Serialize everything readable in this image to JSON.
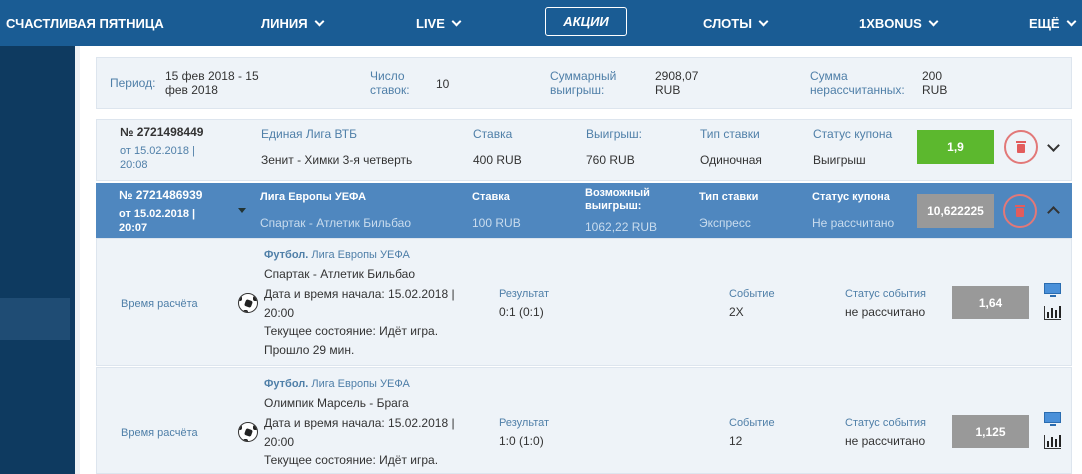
{
  "nav": {
    "items": [
      "СЧАСТЛИВАЯ ПЯТНИЦА",
      "ЛИНИЯ",
      "LIVE",
      "АКЦИИ",
      "СЛОТЫ",
      "1XBONUS",
      "ЕЩЁ"
    ]
  },
  "summary": {
    "period_label": "Период:",
    "period_value": "15 фев 2018 - 15 фев 2018",
    "bets_label": "Число ставок:",
    "bets_value": "10",
    "total_win_label": "Суммарный выигрыш:",
    "total_win_value": "2908,07 RUB",
    "unsettled_label": "Сумма нерассчитанных:",
    "unsettled_value": "200 RUB"
  },
  "coupons": [
    {
      "number": "№ 2721498449",
      "date": "от 15.02.2018 | 20:08",
      "league": "Единая Лига ВТБ",
      "match": "Зенит - Химки 3-я четверть",
      "stake_label": "Ставка",
      "stake_value": "400 RUB",
      "win_label": "Выигрыш:",
      "win_value": "760 RUB",
      "type_label": "Тип ставки",
      "type_value": "Одиночная",
      "status_label": "Статус купона",
      "status_value": "Выигрыш",
      "odds": "1,9"
    },
    {
      "number": "№ 2721486939",
      "date": "от 15.02.2018 | 20:07",
      "league": "Лига Европы УЕФА",
      "match": "Спартак - Атлетик Бильбао",
      "stake_label": "Ставка",
      "stake_value": "100 RUB",
      "win_label": "Возможный выигрыш:",
      "win_value": "1062,22 RUB",
      "type_label": "Тип ставки",
      "type_value": "Экспресс",
      "status_label": "Статус купона",
      "status_value": "Не рассчитано",
      "odds": "10,622225"
    }
  ],
  "events": [
    {
      "calc_time_label": "Время расчёта",
      "sport": "Футбол.",
      "league": "Лига Европы УЕФА",
      "match": "Спартак - Атлетик Бильбао",
      "start_label": "Дата и время начала: 15.02.2018 |",
      "start_time": "20:00",
      "state": "Текущее состояние: Идёт игра.",
      "elapsed": "Прошло 29 мин.",
      "result_label": "Результат",
      "result_value": "0:1 (0:1)",
      "event_label": "Событие",
      "event_value": "2X",
      "event_status_label": "Статус события",
      "event_status_value": "не рассчитано",
      "odds": "1,64"
    },
    {
      "calc_time_label": "Время расчёта",
      "sport": "Футбол.",
      "league": "Лига Европы УЕФА",
      "match": "Олимпик Марсель - Брага",
      "start_label": "Дата и время начала: 15.02.2018 |",
      "start_time": "20:00",
      "state": "Текущее состояние: Идёт игра.",
      "elapsed": "",
      "result_label": "Результат",
      "result_value": "1:0 (1:0)",
      "event_label": "Событие",
      "event_value": "12",
      "event_status_label": "Статус события",
      "event_status_value": "не рассчитано",
      "odds": "1,125"
    }
  ],
  "colors": {
    "nav_bg": "#1a5c94",
    "win_green": "#5cb82e",
    "odds_gray": "#999999",
    "coupon_active_bg": "#4f87bf"
  }
}
